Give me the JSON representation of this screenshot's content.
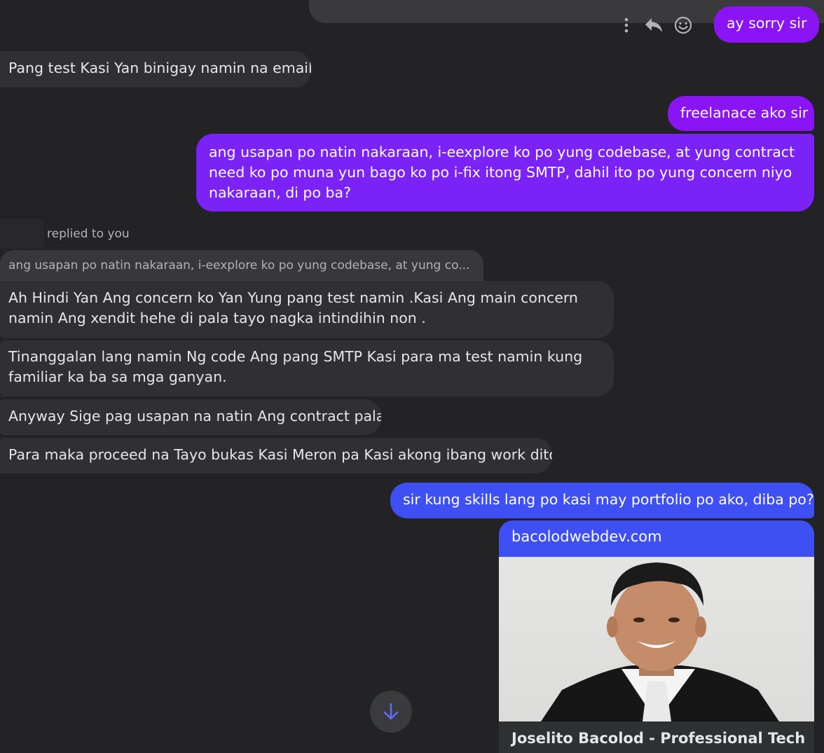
{
  "messages": {
    "ay_sorry": "ay sorry sir",
    "pang_test": "Pang test Kasi Yan binigay namin na email",
    "freelance": "freelanace ako sir",
    "usapan_line1": "ang usapan po natin nakaraan, i-eexplore ko po yung codebase, at yung contract",
    "usapan_line2": "need ko po muna yun bago ko po i-fix itong SMTP, dahil ito po yung concern niyo",
    "usapan_line3": "nakaraan, di po ba?",
    "reply_label": "replied to you",
    "quoted_text": "ang usapan po natin nakaraan, i-eexplore ko po yung codebase, at yung co...",
    "hindi_line1": "Ah Hindi Yan Ang concern ko Yan Yung pang test namin .Kasi Ang main concern",
    "hindi_line2": "namin Ang xendit hehe di pala tayo nagka intindihin non .",
    "tinanggalan_line1": "Tinanggalan lang namin Ng code Ang pang SMTP Kasi para ma test namin kung",
    "tinanggalan_line2": "familiar ka ba sa mga ganyan.",
    "anyway": "Anyway Sige pag usapan na natin Ang contract pala",
    "para_maka": "Para maka proceed na Tayo bukas Kasi Meron pa Kasi akong ibang work dito",
    "skills": "sir kung skills lang po kasi may portfolio po ako, diba po?"
  },
  "link_preview": {
    "domain": "bacolodwebdev.com",
    "title": "Joselito Bacolod - Professional Tech"
  },
  "colors": {
    "background": "#232325",
    "incoming_bubble": "#303032",
    "outgoing_purple": "#8a14f4",
    "outgoing_blue": "#3e4ff3"
  },
  "icons": [
    "more-vertical-icon",
    "reply-icon",
    "emoji-icon",
    "arrow-down-icon"
  ]
}
